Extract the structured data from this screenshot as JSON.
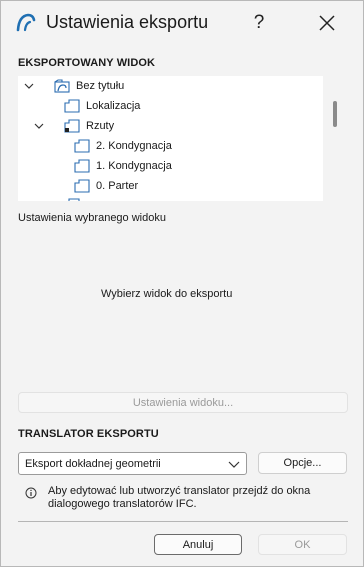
{
  "window": {
    "title": "Ustawienia eksportu",
    "help_label": "?"
  },
  "export_view": {
    "heading": "EKSPORTOWANY WIDOK",
    "tree": [
      {
        "label": "Bez tytułu",
        "icon": "project-icon",
        "expander": "expanded"
      },
      {
        "label": "Lokalizacja",
        "icon": "view-icon",
        "expander": "none"
      },
      {
        "label": "Rzuty",
        "icon": "folder-view-icon",
        "expander": "expanded"
      },
      {
        "label": "2. Kondygnacja",
        "icon": "view-icon",
        "expander": "none"
      },
      {
        "label": "1. Kondygnacja",
        "icon": "view-icon",
        "expander": "none"
      },
      {
        "label": "0. Parter",
        "icon": "view-icon",
        "expander": "none"
      }
    ]
  },
  "selected_view": {
    "heading": "Ustawienia wybranego widoku",
    "placeholder": "Wybierz widok do eksportu",
    "settings_button": "Ustawienia widoku..."
  },
  "translator": {
    "heading": "TRANSLATOR EKSPORTU",
    "selected": "Eksport dokładnej geometrii",
    "options_button": "Opcje...",
    "info": "Aby edytować lub utworzyć translator przejdź do okna dialogowego translatorów IFC."
  },
  "footer": {
    "cancel_label": "Anuluj",
    "ok_label": "OK"
  },
  "colors": {
    "accent": "#1f6fb2",
    "icon_stroke": "#2b6cb0"
  }
}
